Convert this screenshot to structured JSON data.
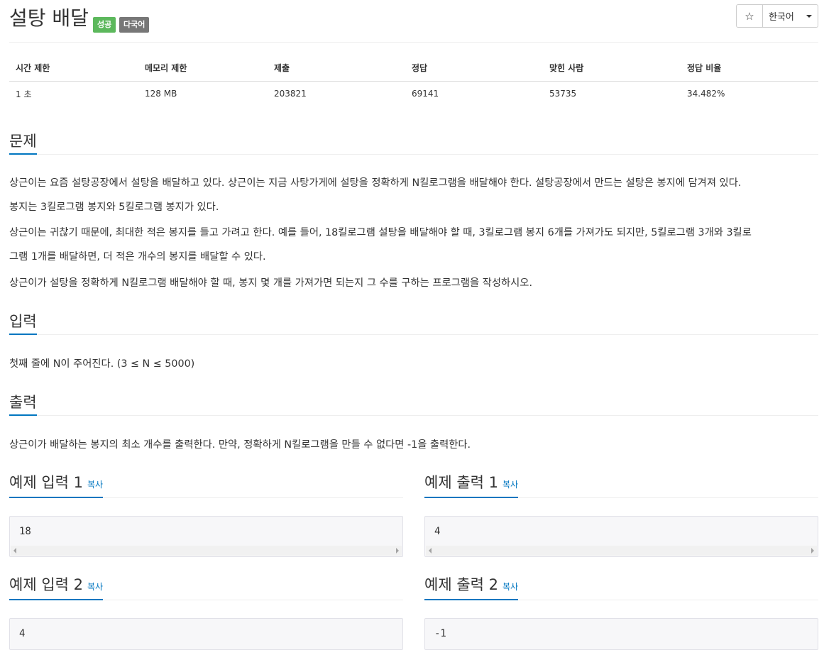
{
  "problem": {
    "title": "설탕 배달",
    "badges": {
      "success": "성공",
      "multilang": "다국어"
    }
  },
  "toolbar": {
    "star_icon": "☆",
    "language": "한국어"
  },
  "info_table": {
    "headers": [
      "시간 제한",
      "메모리 제한",
      "제출",
      "정답",
      "맞힌 사람",
      "정답 비율"
    ],
    "values": [
      "1 초",
      "128 MB",
      "203821",
      "69141",
      "53735",
      "34.482%"
    ]
  },
  "sections": {
    "problem_heading": "문제",
    "problem_paragraphs": [
      "상근이는 요즘 설탕공장에서 설탕을 배달하고 있다. 상근이는 지금 사탕가게에 설탕을 정확하게 N킬로그램을 배달해야 한다. 설탕공장에서 만드는 설탕은 봉지에 담겨져 있다.",
      "봉지는 3킬로그램 봉지와 5킬로그램 봉지가 있다.",
      "상근이는 귀찮기 때문에, 최대한 적은 봉지를 들고 가려고 한다. 예를 들어, 18킬로그램 설탕을 배달해야 할 때, 3킬로그램 봉지 6개를 가져가도 되지만, 5킬로그램 3개와 3킬로",
      "그램 1개를 배달하면, 더 적은 개수의 봉지를 배달할 수 있다.",
      "상근이가 설탕을 정확하게 N킬로그램 배달해야 할 때, 봉지 몇 개를 가져가면 되는지 그 수를 구하는 프로그램을 작성하시오."
    ],
    "input_heading": "입력",
    "input_text": "첫째 줄에 N이 주어진다. (3 ≤ N ≤ 5000)",
    "output_heading": "출력",
    "output_text": "상근이가 배달하는 봉지의 최소 개수를 출력한다. 만약, 정확하게 N킬로그램을 만들 수 없다면 -1을 출력한다."
  },
  "samples": {
    "copy_label": "복사",
    "items": [
      {
        "input_heading": "예제 입력 1",
        "input": "18",
        "output_heading": "예제 출력 1",
        "output": "4"
      },
      {
        "input_heading": "예제 입력 2",
        "input": "4",
        "output_heading": "예제 출력 2",
        "output": "-1"
      }
    ]
  }
}
